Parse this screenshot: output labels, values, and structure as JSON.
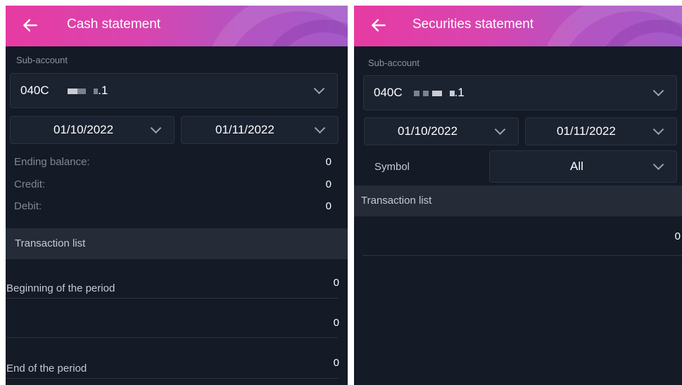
{
  "cash": {
    "title": "Cash statement",
    "sub_account_label": "Sub-account",
    "sub_account_prefix": "040C",
    "sub_account_suffix": ".1",
    "from_date": "01/10/2022",
    "to_date": "01/11/2022",
    "summary": [
      {
        "label": "Ending balance:",
        "value": "0"
      },
      {
        "label": "Credit:",
        "value": "0"
      },
      {
        "label": "Debit:",
        "value": "0"
      }
    ],
    "transaction_list_label": "Transaction list",
    "rows": [
      {
        "label": "Beginning of the period",
        "value": "0"
      },
      {
        "label": "",
        "value": "0"
      },
      {
        "label": "End of the period",
        "value": "0"
      }
    ]
  },
  "securities": {
    "title": "Securities statement",
    "sub_account_label": "Sub-account",
    "sub_account_prefix": "040C",
    "sub_account_suffix": ".1",
    "from_date": "01/10/2022",
    "to_date": "01/11/2022",
    "symbol_label": "Symbol",
    "symbol_value": "All",
    "transaction_list_label": "Transaction list",
    "rows": [
      {
        "value": "0"
      }
    ]
  },
  "colors": {
    "header_start": "#e63ba2",
    "header_end": "#a35bc8",
    "background": "#141a26",
    "section": "#252b37"
  }
}
